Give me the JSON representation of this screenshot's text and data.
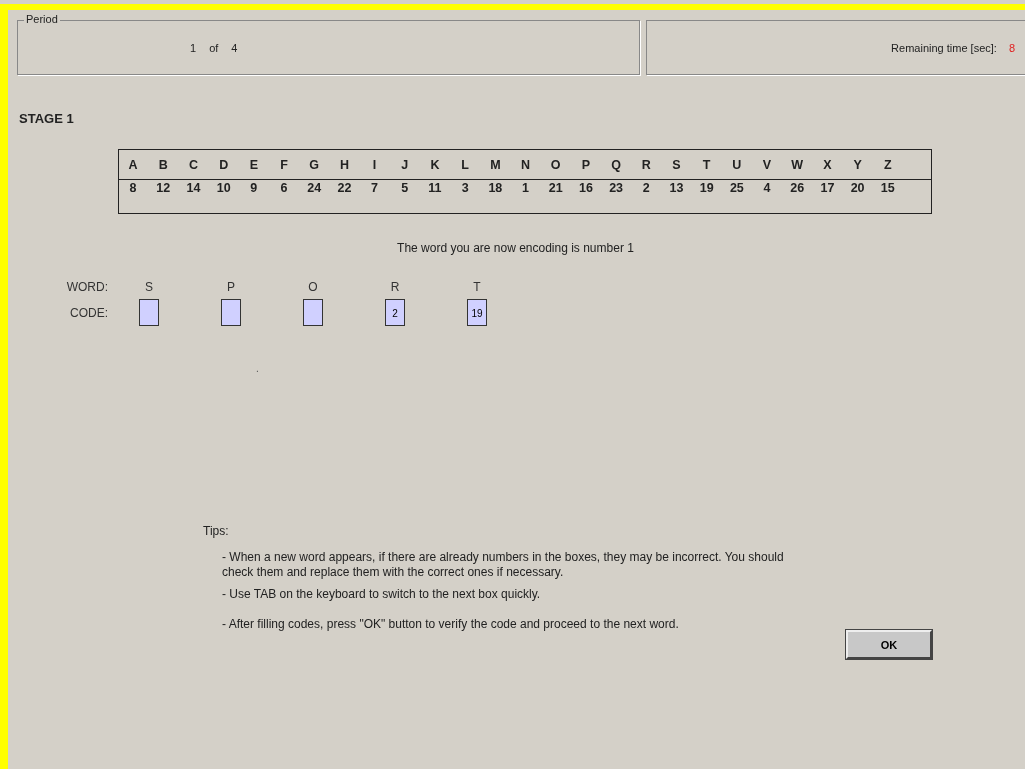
{
  "period": {
    "legend": "Period",
    "current": "1",
    "of": "of",
    "total": "4"
  },
  "timer": {
    "label": "Remaining time [sec]:",
    "value": "8"
  },
  "stage_title": "STAGE 1",
  "code_table": {
    "letters": [
      "A",
      "B",
      "C",
      "D",
      "E",
      "F",
      "G",
      "H",
      "I",
      "J",
      "K",
      "L",
      "M",
      "N",
      "O",
      "P",
      "Q",
      "R",
      "S",
      "T",
      "U",
      "V",
      "W",
      "X",
      "Y",
      "Z"
    ],
    "codes": [
      "8",
      "12",
      "14",
      "10",
      "9",
      "6",
      "24",
      "22",
      "7",
      "5",
      "11",
      "3",
      "18",
      "1",
      "21",
      "16",
      "23",
      "2",
      "13",
      "19",
      "25",
      "4",
      "26",
      "17",
      "20",
      "15"
    ]
  },
  "message": "The word you are now encoding is number 1",
  "word_label": "WORD:",
  "code_label": "CODE:",
  "fields": [
    {
      "letter": "S"
    },
    {
      "letter": "P"
    },
    {
      "letter": "O"
    },
    {
      "letter": "R",
      "value": "2"
    },
    {
      "letter": "T",
      "value": "19"
    }
  ],
  "stray_mark": ".",
  "tips": {
    "title": "Tips:",
    "items": [
      "-  When a new word appears, if there are already numbers in the boxes, they may be incorrect. You should check them and replace them with the correct ones if necessary.",
      "-  Use TAB on the keyboard to switch to the next box quickly.",
      "-  After filling codes, press \"OK\" button to verify the code and proceed to the next word."
    ]
  },
  "ok_button": "OK"
}
